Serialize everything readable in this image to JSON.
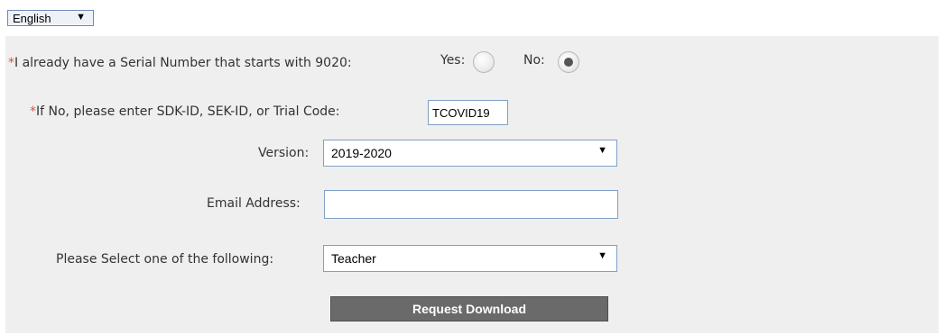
{
  "language": {
    "selected": "English",
    "arrow": "▼"
  },
  "form": {
    "serial": {
      "asterisk": "*",
      "label": "I already have a Serial Number that starts with 9020:",
      "yes_label": "Yes:",
      "no_label": "No:",
      "selected": "No"
    },
    "code": {
      "asterisk": "*",
      "label": "If No, please enter SDK-ID, SEK-ID, or Trial Code:",
      "value": "TCOVID19"
    },
    "version": {
      "label": "Version:",
      "selected": "2019-2020",
      "arrow": "▼"
    },
    "email": {
      "label": "Email Address:",
      "value": ""
    },
    "role": {
      "label": "Please Select one of the following:",
      "selected": "Teacher",
      "arrow": "▼"
    },
    "submit_label": "Request Download"
  },
  "colors": {
    "required_asterisk": "#d9534f",
    "panel_background": "#efefef",
    "button_background": "#6a6a6a"
  }
}
